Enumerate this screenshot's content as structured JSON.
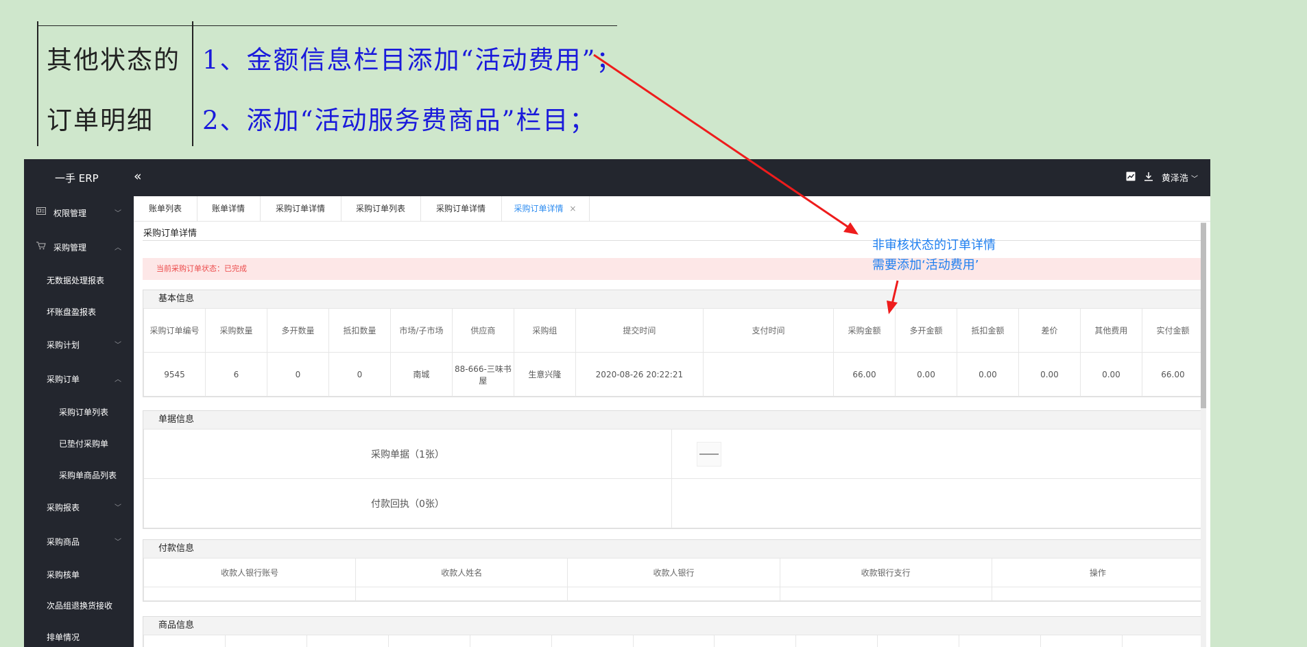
{
  "note": {
    "left_line1": "其他状态的",
    "left_line2": "订单明细",
    "right_line1": "1、金额信息栏目添加“活动费用”；",
    "right_line2": "2、添加“活动服务费商品”栏目；"
  },
  "annotation": {
    "line1": "非审核状态的订单详情",
    "line2": "需要添加‘活动费用’",
    "color": "#1e7ff0",
    "arrow_color": "#ee1c1c"
  },
  "app": {
    "title": "一手 ERP",
    "collapse_glyph": "«",
    "user_name": "黄泽浩",
    "topbar_icons": [
      "chart-icon",
      "download-icon"
    ]
  },
  "sidebar": {
    "items": [
      {
        "label": "权限管理",
        "icon": "id-card-icon",
        "chevron": "﹀"
      },
      {
        "label": "采购管理",
        "icon": "cart-icon",
        "chevron": "︿"
      },
      {
        "label": "无数据处理报表"
      },
      {
        "label": "坏账盘盈报表"
      },
      {
        "label": "采购计划",
        "chevron": "﹀"
      },
      {
        "label": "采购订单",
        "chevron": "︿"
      },
      {
        "label": "采购订单列表"
      },
      {
        "label": "已垫付采购单"
      },
      {
        "label": "采购单商品列表"
      },
      {
        "label": "采购报表",
        "chevron": "﹀"
      },
      {
        "label": "采购商品",
        "chevron": "﹀"
      },
      {
        "label": "采购核单"
      },
      {
        "label": "次品组退换货接收"
      },
      {
        "label": "排单情况"
      }
    ]
  },
  "tabs": [
    {
      "label": "账单列表"
    },
    {
      "label": "账单详情"
    },
    {
      "label": "采购订单详情"
    },
    {
      "label": "采购订单列表"
    },
    {
      "label": "采购订单详情"
    },
    {
      "label": "采购订单详情",
      "active": true,
      "close": "×"
    }
  ],
  "page": {
    "title": "采购订单详情",
    "status_text": "当前采购订单状态：已完成"
  },
  "basic_info": {
    "title": "基本信息",
    "headers": [
      "采购订单编号",
      "采购数量",
      "多开数量",
      "抵扣数量",
      "市场/子市场",
      "供应商",
      "采购组",
      "提交时间",
      "支付时间",
      "采购金额",
      "多开金额",
      "抵扣金额",
      "差价",
      "其他费用",
      "实付金额"
    ],
    "row": [
      "9545",
      "6",
      "0",
      "0",
      "南城",
      "88-666-三味书屋",
      "生意兴隆",
      "2020-08-26 20:22:21",
      "",
      "66.00",
      "0.00",
      "0.00",
      "0.00",
      "0.00",
      "66.00"
    ]
  },
  "docs_info": {
    "title": "单据信息",
    "rows": [
      {
        "label": "采购单据（1张）",
        "has_thumbnail": true
      },
      {
        "label": "付款回执（0张）",
        "has_thumbnail": false
      }
    ]
  },
  "payment_info": {
    "title": "付款信息",
    "headers": [
      "收款人银行账号",
      "收款人姓名",
      "收款人银行",
      "收款银行支行",
      "操作"
    ]
  },
  "goods_info": {
    "title": "商品信息"
  }
}
